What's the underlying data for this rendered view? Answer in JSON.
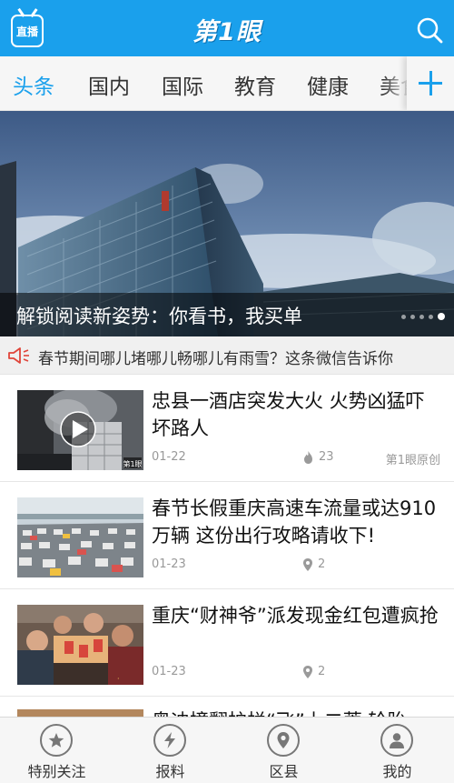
{
  "header": {
    "live_label": "直播",
    "logo_text": "第1眼"
  },
  "tabs": [
    "头条",
    "国内",
    "国际",
    "教育",
    "健康",
    "美食"
  ],
  "hero": {
    "title": "解锁阅读新姿势：你看书，我买单",
    "slide_count": 5,
    "active_slide": 5
  },
  "ticker": {
    "text": "春节期间哪儿堵哪儿畅哪儿有雨雪？这条微信告诉你"
  },
  "news": [
    {
      "title": "忠县一酒店突发大火 火势凶猛吓坏路人",
      "date": "01-22",
      "stat_icon": "fire-icon",
      "stat": "23",
      "source": "第1眼原创",
      "has_video": true
    },
    {
      "title": "春节长假重庆高速车流量或达910万辆 这份出行攻略请收下!",
      "date": "01-23",
      "stat_icon": "location-pin-icon",
      "stat": "2",
      "source": "",
      "has_video": false
    },
    {
      "title": "重庆“财神爷”派发现金红包遭疯抢",
      "date": "01-23",
      "stat_icon": "location-pin-icon",
      "stat": "2",
      "source": "",
      "has_video": false
    },
    {
      "title": "奥迪撞翻护栏“飞”上二蒂 轮胎",
      "date": "",
      "stat_icon": "",
      "stat": "",
      "source": "",
      "has_video": false
    }
  ],
  "bottom_nav": [
    {
      "label": "特别关注",
      "icon": "star-icon"
    },
    {
      "label": "报料",
      "icon": "lightning-icon"
    },
    {
      "label": "区县",
      "icon": "location-pin-icon"
    },
    {
      "label": "我的",
      "icon": "user-icon"
    }
  ],
  "colors": {
    "brand_blue": "#1aa0ec",
    "ticker_red": "#e0453a"
  }
}
